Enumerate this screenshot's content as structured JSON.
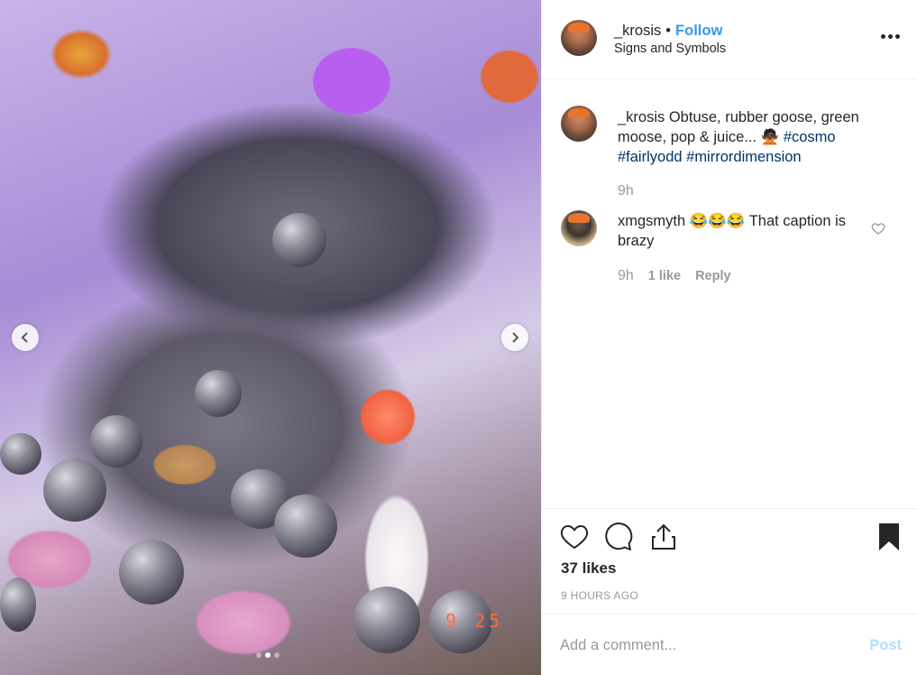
{
  "media": {
    "prev_icon": "chevron-left-icon",
    "next_icon": "chevron-right-icon",
    "carousel": {
      "count": 3,
      "active_index": 1
    },
    "digital_clock": "9 25"
  },
  "header": {
    "username": "_krosis",
    "separator": "•",
    "follow_label": "Follow",
    "subtitle": "Signs and Symbols",
    "more_icon": "more-options-icon"
  },
  "caption": {
    "username": "_krosis",
    "text_pre": " Obtuse, rubber goose, green moose, pop & juice... ",
    "emoji": "🙅🏿",
    "tags": [
      "#cosmo",
      "#fairlyodd",
      "#mirrordimension"
    ],
    "time": "9h"
  },
  "comments": [
    {
      "username": "xmgsmyth",
      "text": " 😂😂😂 That caption is brazy",
      "time": "9h",
      "likes_label": "1 like",
      "reply_label": "Reply"
    }
  ],
  "actions": {
    "like_icon": "heart-icon",
    "comment_icon": "comment-icon",
    "share_icon": "share-icon",
    "save_icon": "bookmark-icon"
  },
  "likes": "37 likes",
  "posted_time": "9 HOURS AGO",
  "add_comment": {
    "placeholder": "Add a comment...",
    "post_label": "Post"
  },
  "colors": {
    "link": "#3897f0",
    "hashtag": "#003569",
    "muted": "#999999",
    "post_disabled": "#b2dffc"
  }
}
